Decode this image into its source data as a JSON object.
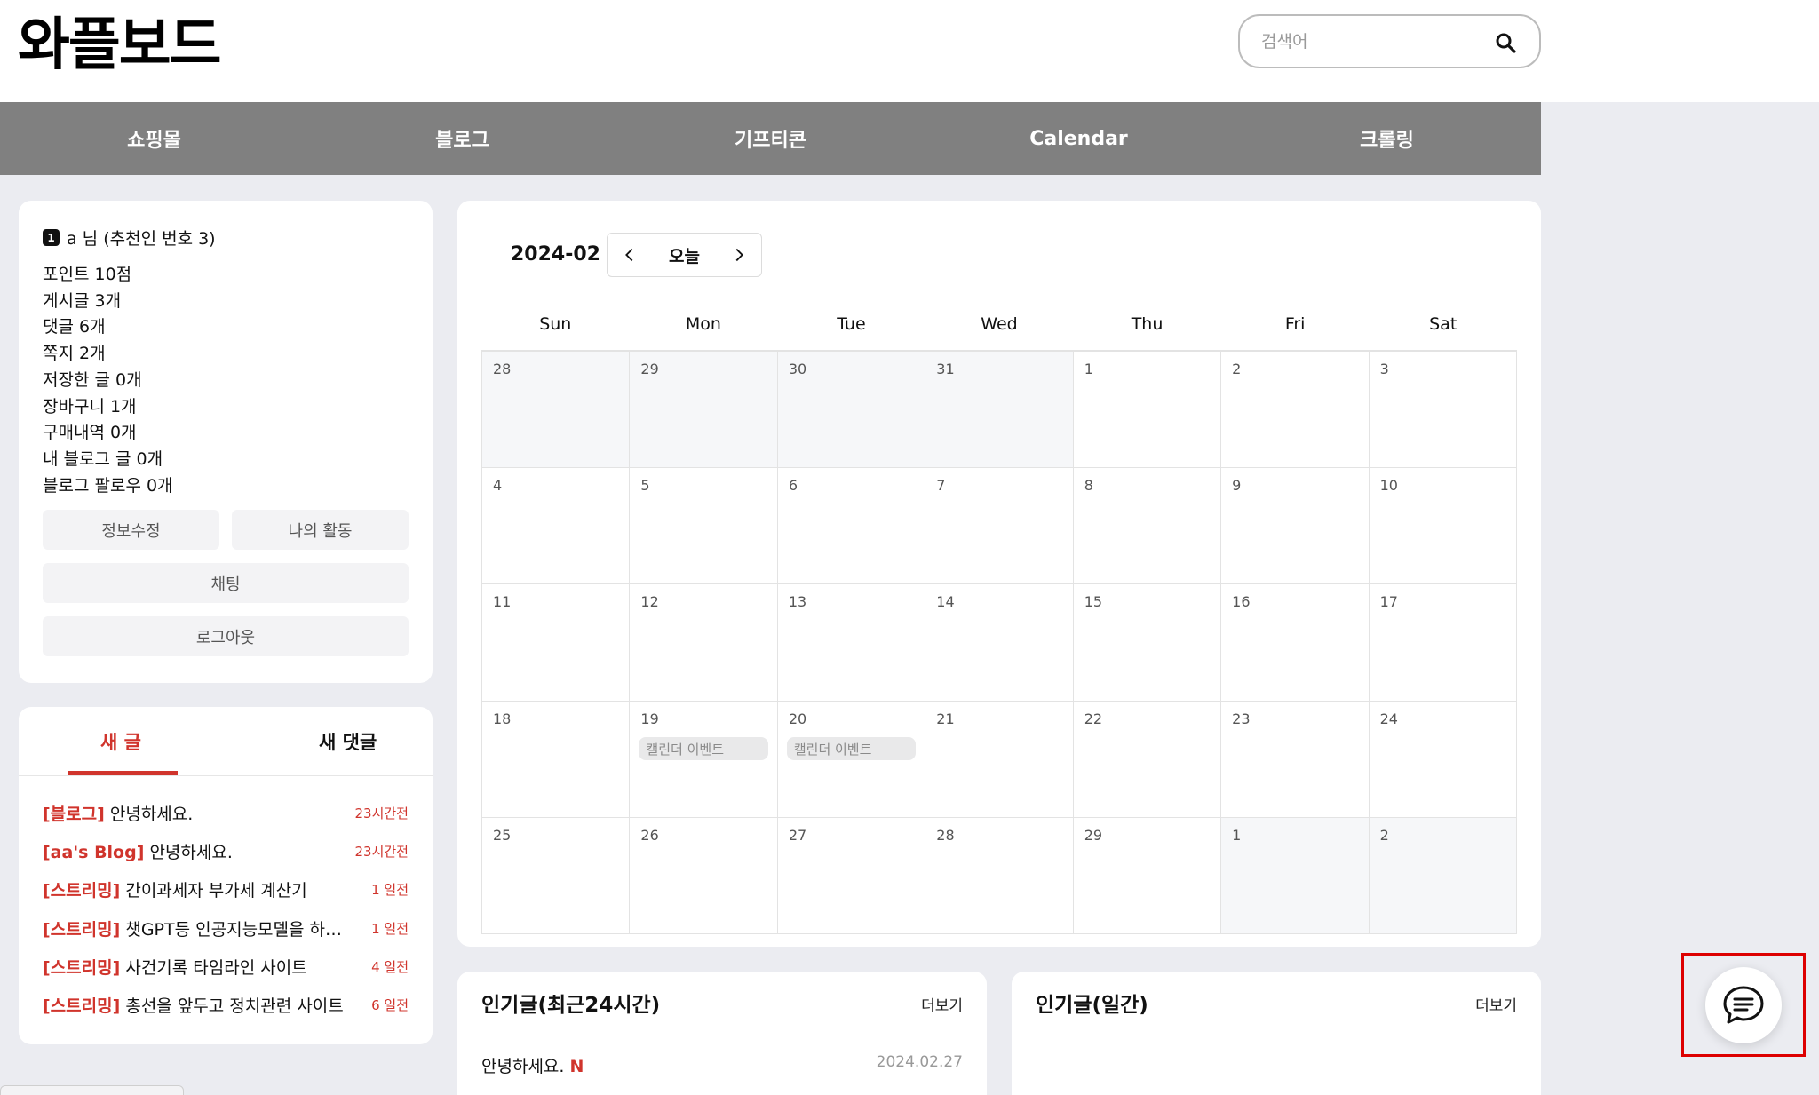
{
  "header": {
    "logo": "와플보드",
    "search_placeholder": "검색어",
    "search_icon": "search-icon"
  },
  "nav": {
    "items": [
      "쇼핑몰",
      "블로그",
      "기프티콘",
      "Calendar",
      "크롤링"
    ]
  },
  "profile": {
    "rank": "1",
    "name": "a 님 (추천인 번호 3)",
    "stats": [
      "포인트 10점",
      "게시글 3개",
      "댓글 6개",
      "쪽지 2개",
      "저장한 글 0개",
      "장바구니 1개",
      "구매내역 0개",
      "내 블로그 글 0개",
      "블로그 팔로우 0개"
    ],
    "edit_info": "정보수정",
    "my_activity": "나의 활동",
    "chat": "채팅",
    "logout": "로그아웃"
  },
  "new_posts": {
    "tab_posts": "새 글",
    "tab_comments": "새 댓글",
    "items": [
      {
        "category": "[블로그]",
        "title": "안녕하세요.",
        "time": "23시간전"
      },
      {
        "category": "[aa's Blog]",
        "title": "안녕하세요.",
        "time": "23시간전"
      },
      {
        "category": "[스트리밍]",
        "title": "간이과세자 부가세 계산기",
        "time": "1 일전"
      },
      {
        "category": "[스트리밍]",
        "title": "챗GPT등 인공지능모델을 하…",
        "time": "1 일전"
      },
      {
        "category": "[스트리밍]",
        "title": "사건기록 타임라인 사이트",
        "time": "4 일전"
      },
      {
        "category": "[스트리밍]",
        "title": "총선을 앞두고 정치관련 사이트",
        "time": "6 일전"
      }
    ]
  },
  "calendar": {
    "month": "2024-02",
    "today": "오늘",
    "weekdays": [
      "Sun",
      "Mon",
      "Tue",
      "Wed",
      "Thu",
      "Fri",
      "Sat"
    ],
    "weeks": [
      [
        {
          "d": "28",
          "other": true
        },
        {
          "d": "29",
          "other": true
        },
        {
          "d": "30",
          "other": true
        },
        {
          "d": "31",
          "other": true
        },
        {
          "d": "1"
        },
        {
          "d": "2"
        },
        {
          "d": "3"
        }
      ],
      [
        {
          "d": "4"
        },
        {
          "d": "5"
        },
        {
          "d": "6"
        },
        {
          "d": "7"
        },
        {
          "d": "8"
        },
        {
          "d": "9"
        },
        {
          "d": "10"
        }
      ],
      [
        {
          "d": "11"
        },
        {
          "d": "12"
        },
        {
          "d": "13"
        },
        {
          "d": "14"
        },
        {
          "d": "15"
        },
        {
          "d": "16"
        },
        {
          "d": "17"
        }
      ],
      [
        {
          "d": "18"
        },
        {
          "d": "19",
          "event": "캘린더 이벤트"
        },
        {
          "d": "20",
          "event": "캘린더 이벤트"
        },
        {
          "d": "21"
        },
        {
          "d": "22"
        },
        {
          "d": "23"
        },
        {
          "d": "24"
        }
      ],
      [
        {
          "d": "25"
        },
        {
          "d": "26"
        },
        {
          "d": "27"
        },
        {
          "d": "28"
        },
        {
          "d": "29"
        },
        {
          "d": "1",
          "other": true
        },
        {
          "d": "2",
          "other": true
        }
      ]
    ]
  },
  "popular_24h": {
    "title": "인기글(최근24시간)",
    "more": "더보기",
    "item_title": "안녕하세요.",
    "item_new": "N",
    "item_date": "2024.02.27"
  },
  "popular_daily": {
    "title": "인기글(일간)",
    "more": "더보기"
  },
  "colors": {
    "accent": "#d0342c",
    "nav_bg": "#808080",
    "page_bg": "#ebecf1"
  },
  "chat_fab_icon": "chat-bubble-icon"
}
